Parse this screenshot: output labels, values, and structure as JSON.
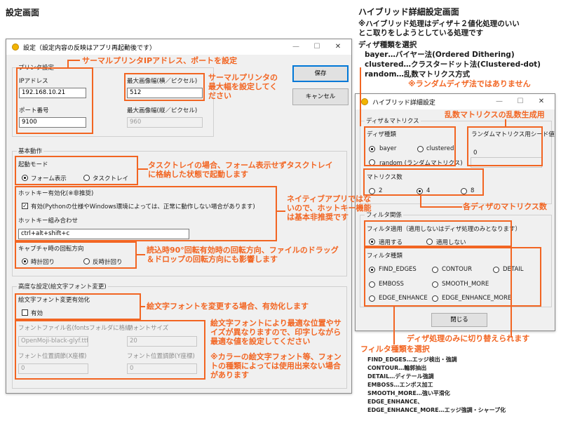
{
  "headings": {
    "settings_screen": "設定画面",
    "hybrid_screen": "ハイブリッド詳細設定画面",
    "hybrid_note_line1": "※ハイブリッド処理はディザ＋２値化処理のいい",
    "hybrid_note_line2": "とこ取りをしようとしている処理です"
  },
  "colors": {
    "accent": "#f26522",
    "window_bg": "#f0f0f0",
    "default_button_border": "#0078d7",
    "title_icon": "#f2b400"
  },
  "settings_window": {
    "title": "設定（設定内容の反映はアプリ再起動後です）",
    "controls": {
      "minimize": "—",
      "maximize": "☐",
      "close": "✕"
    },
    "printer_group": {
      "label": "プリンタ設定",
      "ip_label": "IPアドレス",
      "ip_value": "192.168.10.21",
      "port_label": "ポート番号",
      "port_value": "9100",
      "max_width_label": "最大画像幅(横／ピクセル)",
      "max_width_value": "512",
      "max_height_label": "最大画像幅(縦／ピクセル)",
      "max_height_value": "960"
    },
    "save_button": "保存",
    "cancel_button": "キャンセル",
    "basic_group": {
      "label": "基本動作",
      "startup_mode_label": "起動モード",
      "startup_options": [
        "フォーム表示",
        "タスクトレイ"
      ],
      "startup_selected": "フォーム表示",
      "hotkey_enable_label": "ホットキー有効化(※非推奨)",
      "hotkey_enable_checkbox": "有効(Pythonの仕様やWindows環境によっては、正常に動作しない場合があります)",
      "hotkey_enable_checked": true,
      "hotkey_combo_label": "ホットキー組み合わせ",
      "hotkey_combo_value": "ctrl+alt+shift+c",
      "rotation_label": "キャプチャ時の回転方向",
      "rotation_options": [
        "時計回り",
        "反時計回り"
      ],
      "rotation_selected": "時計回り"
    },
    "advanced_group": {
      "label": "高度な設定(絵文字フォント変更)",
      "emoji_enable_label": "絵文字フォント変更有効化",
      "emoji_enable_checkbox": "有効",
      "emoji_enable_checked": false,
      "font_file_label": "フォントファイル名(fontsフォルダに格納)",
      "font_file_value": "OpenMoji-black-glyf.ttf",
      "font_size_label": "フォントサイズ",
      "font_size_value": "20",
      "font_pos_x_label": "フォント位置調節(X座標)",
      "font_pos_x_value": "0",
      "font_pos_y_label": "フォント位置調節(Y座標)",
      "font_pos_y_value": "0"
    }
  },
  "hybrid_window": {
    "title": "ハイブリッド詳細設定",
    "controls": {
      "minimize": "—",
      "maximize": "☐",
      "close": "✕"
    },
    "dither_group": {
      "label": "ディザ＆マトリクス",
      "dither_type_label": "ディザ種類",
      "dither_options": [
        "bayer",
        "clustered",
        "random (ランダムマトリクス)"
      ],
      "dither_selected": "bayer",
      "seed_label": "ランダムマトリクス用シード値",
      "seed_value": "0",
      "matrix_size_label": "マトリクス数",
      "matrix_options": [
        "2",
        "4",
        "8"
      ],
      "matrix_selected": "4"
    },
    "filter_group": {
      "label": "フィルタ関係",
      "filter_apply_label": "フィルタ適用（適用しないはディザ処理のみとなります）",
      "filter_apply_options": [
        "適用する",
        "適用しない"
      ],
      "filter_apply_selected": "適用する",
      "filter_type_label": "フィルタ種類",
      "filter_options": [
        "FIND_EDGES",
        "CONTOUR",
        "DETAIL",
        "EMBOSS",
        "SMOOTH_MORE",
        "EDGE_ENHANCE",
        "EDGE_ENHANCE_MORE"
      ],
      "filter_selected": "FIND_EDGES"
    },
    "close_button": "閉じる"
  },
  "annotations": {
    "printer_ip_port": "サーマルプリンタIPアドレス、ポートを設定",
    "max_width_line1": "サーマルプリンタの",
    "max_width_line2": "最大幅を設定してく",
    "max_width_line3": "ださい",
    "tasktray_line1": "タスクトレイの場合、フォーム表示せずタスクトレイ",
    "tasktray_line2": "に格納した状態で起動します",
    "hotkey_line1": "ネイティブアプリではな",
    "hotkey_line2": "いので、ホットキー機能",
    "hotkey_line3": "は基本非推奨です",
    "rotation_line1": "読込時90°回転有効時の回転方向、ファイルのドラッグ",
    "rotation_line2": "＆ドロップの回転方向にも影響します",
    "emoji_enable": "絵文字フォントを変更する場合、有効化します",
    "emoji_pos_line1": "絵文字フォントにより最適な位置やサ",
    "emoji_pos_line2": "イズが異なりますので、印字しながら",
    "emoji_pos_line3": "最適な値を設定してください",
    "emoji_color_line1": "※カラーの絵文字フォント等、フォン",
    "emoji_color_line2": "トの種類によっては使用出来ない場合",
    "emoji_color_line3": "があります",
    "dither_type_title": "ディザ種類を選択",
    "dither_bayer": "bayer…バイヤー法(Ordered Dithering)",
    "dither_clustered": "clustered…クラスタードット法(Clustered-dot)",
    "dither_random": "random…乱数マトリクス方式",
    "dither_random_note": "※ランダムディザ法ではありません",
    "seed_note": "乱数マトリクスの乱数生成用",
    "matrix_note": "各ディザのマトリクス数",
    "filter_apply_note": "ディザ処理のみに切り替えられます",
    "filter_select_title": "フィルタ種類を選択",
    "filter_descriptions": [
      "FIND_EDGES…エッジ検出・強調",
      "CONTOUR…輪郭抽出",
      "DETAIL…ディテール強調",
      "EMBOSS…エンボス加工",
      "SMOOTH_MORE…強い平滑化",
      "EDGE_ENHANCE、",
      "EDGE_ENHANCE_MORE…エッジ強調・シャープ化"
    ]
  }
}
